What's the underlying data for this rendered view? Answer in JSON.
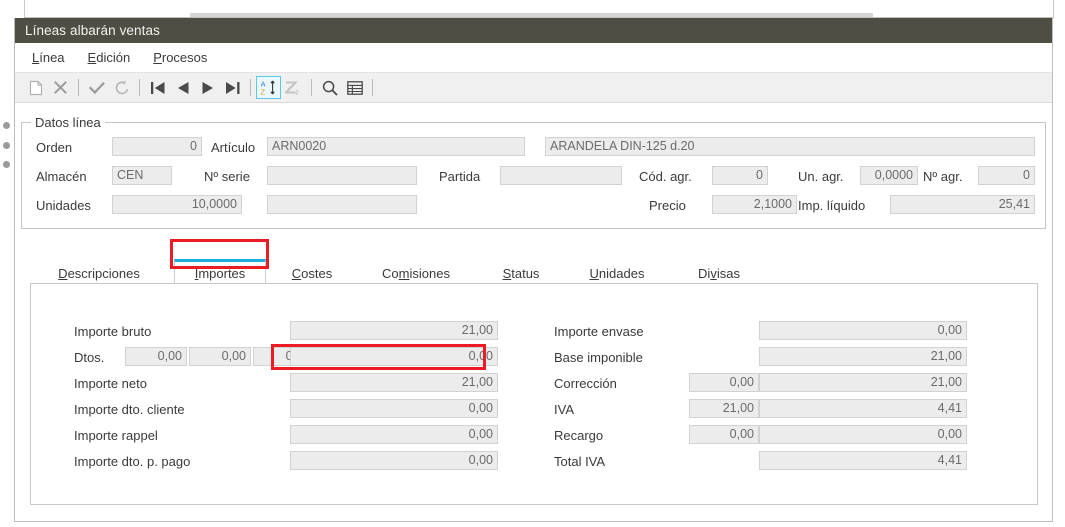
{
  "window": {
    "title": "Líneas albarán ventas"
  },
  "menubar": {
    "items": [
      {
        "name": "menu-linea",
        "pre": "L",
        "rest": "ínea"
      },
      {
        "name": "menu-edicion",
        "pre": "E",
        "rest": "dición"
      },
      {
        "name": "menu-procesos",
        "pre": "P",
        "rest": "rocesos"
      }
    ]
  },
  "toolbar": {
    "buttons": [
      {
        "name": "new-icon",
        "glyph": "new"
      },
      {
        "name": "delete-icon",
        "glyph": "x"
      },
      {
        "name": "separator",
        "glyph": "sep"
      },
      {
        "name": "confirm-icon",
        "glyph": "check"
      },
      {
        "name": "undo-icon",
        "glyph": "undo"
      },
      {
        "name": "separator",
        "glyph": "sep"
      },
      {
        "name": "first-record-icon",
        "glyph": "first"
      },
      {
        "name": "prev-record-icon",
        "glyph": "prev"
      },
      {
        "name": "next-record-icon",
        "glyph": "next"
      },
      {
        "name": "last-record-icon",
        "glyph": "last"
      },
      {
        "name": "separator",
        "glyph": "sep"
      },
      {
        "name": "sort-asc-icon",
        "glyph": "az"
      },
      {
        "name": "sort-desc-icon",
        "glyph": "za"
      },
      {
        "name": "separator",
        "glyph": "sep"
      },
      {
        "name": "search-icon",
        "glyph": "magnifier"
      },
      {
        "name": "grid-view-icon",
        "glyph": "grid"
      },
      {
        "name": "separator",
        "glyph": "sep"
      }
    ]
  },
  "datos_linea": {
    "legend": "Datos línea",
    "orden": {
      "label": "Orden",
      "value": "0"
    },
    "articulo": {
      "label": "Artículo",
      "value": "ARN0020"
    },
    "descripcion": {
      "value": "ARANDELA DIN-125 d.20"
    },
    "almacen": {
      "label": "Almacén",
      "value": "CEN"
    },
    "n_serie": {
      "label": "Nº serie",
      "value": ""
    },
    "partida": {
      "label": "Partida",
      "value": ""
    },
    "cod_agr": {
      "label": "Cód. agr.",
      "value": "0"
    },
    "un_agr": {
      "label": "Un. agr.",
      "value": "0,0000"
    },
    "n_agr": {
      "label": "Nº agr.",
      "value": "0"
    },
    "unidades": {
      "label": "Unidades",
      "value": "10,0000"
    },
    "unidades2": {
      "value": ""
    },
    "precio": {
      "label": "Precio",
      "value": "2,1000"
    },
    "imp_liquido": {
      "label": "Imp. líquido",
      "value": "25,41"
    }
  },
  "tabs": {
    "active": "Importes",
    "items": [
      {
        "name": "tab-descripciones",
        "pre": "D",
        "mid": "",
        "label": "Descripciones"
      },
      {
        "name": "tab-importes",
        "pre": "I",
        "mid": "",
        "label": "Importes"
      },
      {
        "name": "tab-costes",
        "pre": "C",
        "mid": "",
        "label": "Costes"
      },
      {
        "name": "tab-comisiones",
        "pre": "Co",
        "mid": "m",
        "label": "Comisiones"
      },
      {
        "name": "tab-status",
        "pre": "S",
        "mid": "",
        "label": "Status"
      },
      {
        "name": "tab-unidades",
        "pre": "U",
        "mid": "",
        "label": "Unidades"
      },
      {
        "name": "tab-divisas",
        "pre": "Di",
        "mid": "v",
        "label": "Divisas"
      }
    ]
  },
  "importes": {
    "left": [
      {
        "name": "importe-bruto",
        "label": "Importe bruto",
        "value": "21,00"
      },
      {
        "name": "dtos",
        "label": "Dtos.",
        "value": "0,00",
        "extras": [
          "0,00",
          "0,00",
          "0,00"
        ],
        "highlighted": true
      },
      {
        "name": "importe-neto",
        "label": "Importe neto",
        "value": "21,00"
      },
      {
        "name": "importe-dto-cliente",
        "label": "Importe dto. cliente",
        "value": "0,00"
      },
      {
        "name": "importe-rappel",
        "label": "Importe rappel",
        "value": "0,00"
      },
      {
        "name": "importe-dto-p-pago",
        "label": "Importe dto. p. pago",
        "value": "0,00"
      }
    ],
    "right": [
      {
        "name": "importe-envase",
        "label": "Importe envase",
        "aux": "",
        "value": "0,00"
      },
      {
        "name": "base-imponible",
        "label": "Base imponible",
        "aux": "",
        "value": "21,00"
      },
      {
        "name": "correccion",
        "label": "Corrección",
        "aux": "0,00",
        "value": "21,00"
      },
      {
        "name": "iva",
        "label": "IVA",
        "aux": "21,00",
        "value": "4,41"
      },
      {
        "name": "recargo",
        "label": "Recargo",
        "aux": "0,00",
        "value": "0,00"
      },
      {
        "name": "total-iva",
        "label": "Total IVA",
        "aux": "",
        "value": "4,41"
      }
    ]
  },
  "colors": {
    "titlebar": "#4e4e45",
    "accent_tab": "#1eaedb",
    "annotation": "#ed1c24",
    "field_bg": "#ececec"
  }
}
